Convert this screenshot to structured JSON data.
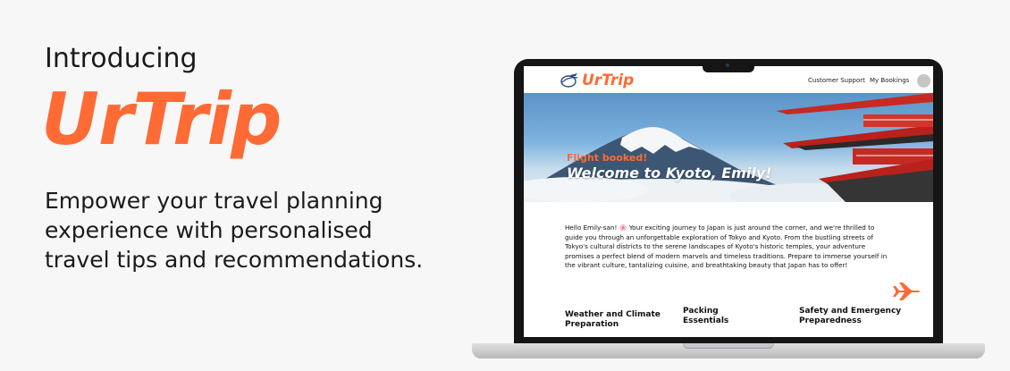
{
  "promo": {
    "intro": "Introducing",
    "brand": "UrTrip",
    "tagline": "Empower your travel planning experience with personalised travel tips and recommendations."
  },
  "app": {
    "logo": "UrTrip",
    "nav": {
      "support": "Customer Support",
      "bookings": "My Bookings"
    },
    "hero": {
      "subtitle": "Flight booked!",
      "title": "Welcome to Kyoto, Emily!"
    },
    "intro_text": "Hello Emily-san! 🌸 Your exciting journey to Japan is just around the corner, and we're thrilled to guide you through an unforgettable exploration of Tokyo and Kyoto. From the bustling streets of Tokyo's cultural districts to the serene landscapes of Kyoto's historic temples, your adventure promises a perfect blend of modern marvels and timeless traditions. Prepare to immerse yourself in the vibrant culture, tantalizing cuisine, and breathtaking beauty that Japan has to offer!",
    "sections": [
      "Weather and Climate Preparation",
      "Packing Essentials",
      "Safety and Emergency Preparedness"
    ]
  },
  "colors": {
    "accent": "#ff6a35",
    "background": "#f7f7f7"
  },
  "icons": [
    "airplane-globe-logo-icon",
    "airplane-icon"
  ]
}
